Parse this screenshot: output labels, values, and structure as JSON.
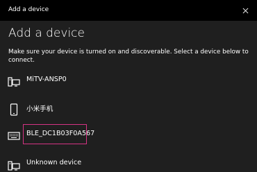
{
  "window": {
    "title": "Add a device",
    "close_icon": "close-icon"
  },
  "page": {
    "heading": "Add a device",
    "instructions": "Make sure your device is turned on and discoverable. Select a device below to connect."
  },
  "devices": [
    {
      "name": "MiTV-ANSP0",
      "icon": "monitor-icon"
    },
    {
      "name": "小米手机",
      "icon": "phone-icon"
    },
    {
      "name": "BLE_DC1B03F0A567",
      "icon": "keyboard-icon"
    },
    {
      "name": "Unknown device",
      "icon": "monitor-icon"
    }
  ],
  "colors": {
    "background": "#1f1f1f",
    "titlebar": "#000000",
    "text": "#ffffff",
    "highlight": "#d63384"
  }
}
